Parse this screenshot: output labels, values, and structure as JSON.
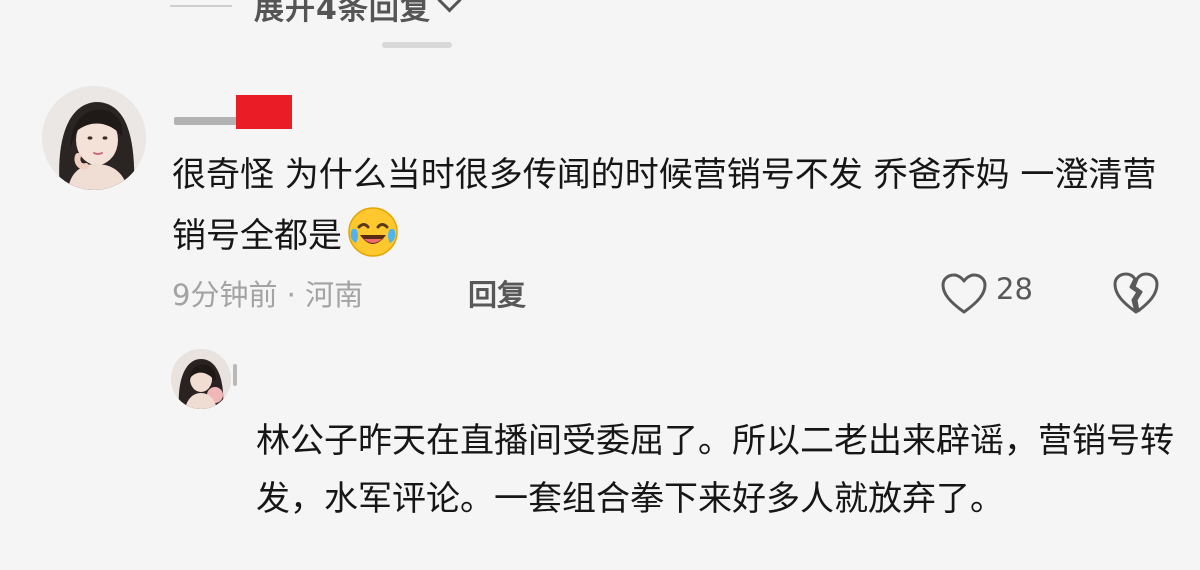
{
  "thread": {
    "expand_label": "展开4条回复"
  },
  "comment": {
    "text": "很奇怪 为什么当时很多传闻的时候营销号不发 乔爸乔妈 一澄清营销号全都是",
    "emoji": "laughing-crying-emoji",
    "time_location": "9分钟前 · 河南",
    "reply_label": "回复",
    "like_count": "28"
  },
  "reply": {
    "text": "林公子昨天在直播间受委屈了。所以二老出来辟谣，营销号转发，水军评论。一套组合拳下来好多人就放弃了。"
  },
  "icons": {
    "expand": "chevron-down-icon",
    "like": "heart-outline-icon",
    "dislike": "broken-heart-icon"
  },
  "colors": {
    "background": "#f5f5f5",
    "text_primary": "#161616",
    "text_secondary": "#a3a3a3",
    "text_action": "#585858",
    "redaction": "#ea1d27"
  }
}
